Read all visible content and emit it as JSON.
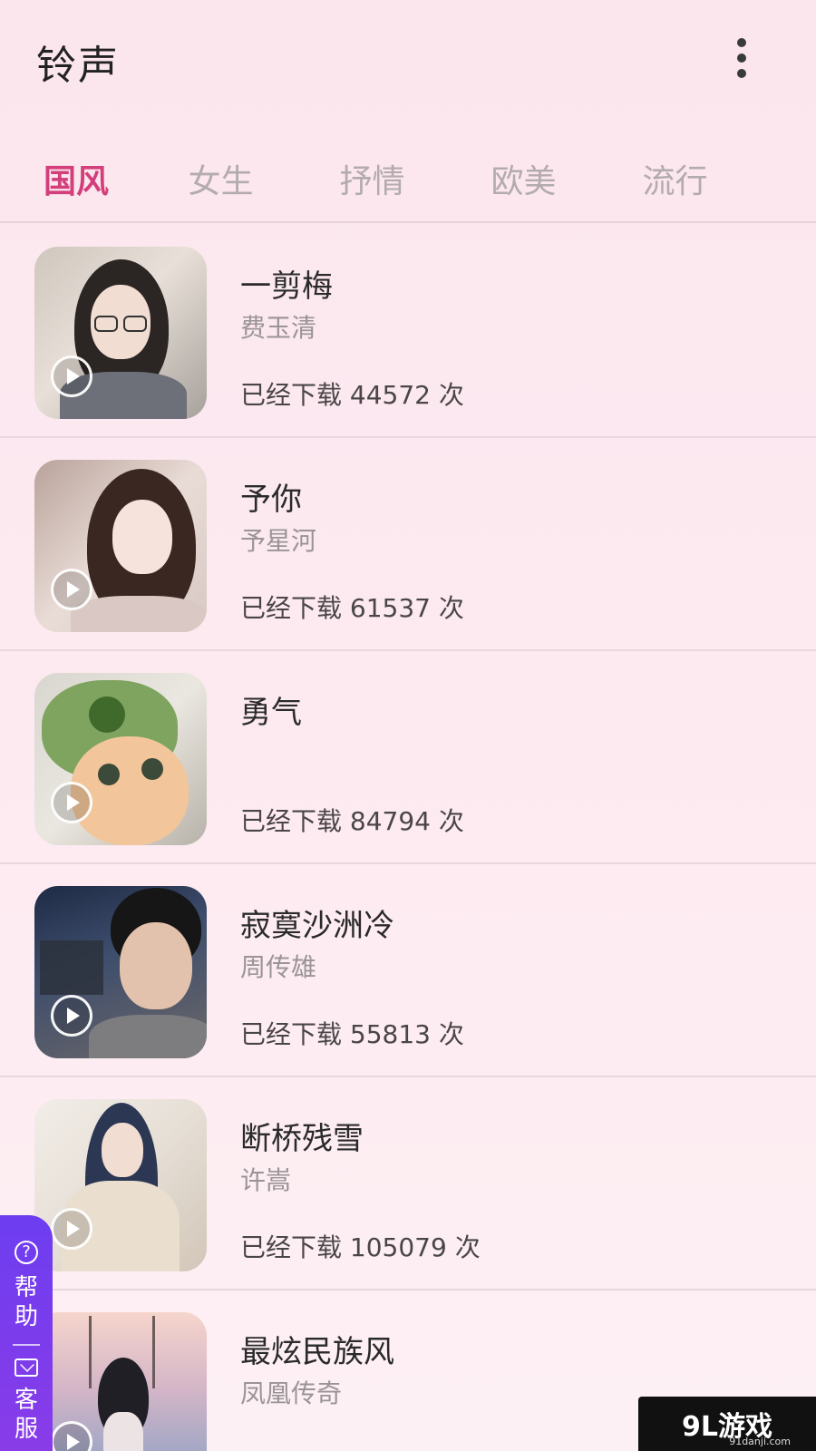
{
  "header": {
    "title": "铃声",
    "more_icon": "more-vertical-icon"
  },
  "tabs": [
    {
      "label": "国风",
      "active": true
    },
    {
      "label": "女生",
      "active": false
    },
    {
      "label": "抒情",
      "active": false
    },
    {
      "label": "欧美",
      "active": false
    },
    {
      "label": "流行",
      "active": false
    }
  ],
  "songs": [
    {
      "title": "一剪梅",
      "artist": "费玉清",
      "downloads": "已经下载 44572 次"
    },
    {
      "title": "予你",
      "artist": "予星河",
      "downloads": "已经下载 61537 次"
    },
    {
      "title": "勇气",
      "artist": "",
      "downloads": "已经下载 84794 次"
    },
    {
      "title": "寂寞沙洲冷",
      "artist": "周传雄",
      "downloads": "已经下载 55813 次"
    },
    {
      "title": "断桥残雪",
      "artist": "许嵩",
      "downloads": "已经下载 105079 次"
    },
    {
      "title": "最炫民族风",
      "artist": "凤凰传奇",
      "downloads": ""
    }
  ],
  "help_widget": {
    "help_label": "帮助",
    "service_label": "客服"
  },
  "watermark": {
    "brand": "9L游戏",
    "url": "91danji.com"
  },
  "colors": {
    "accent": "#d33f7b",
    "background": "#fde9f0",
    "help_purple": "#7a3cec"
  }
}
